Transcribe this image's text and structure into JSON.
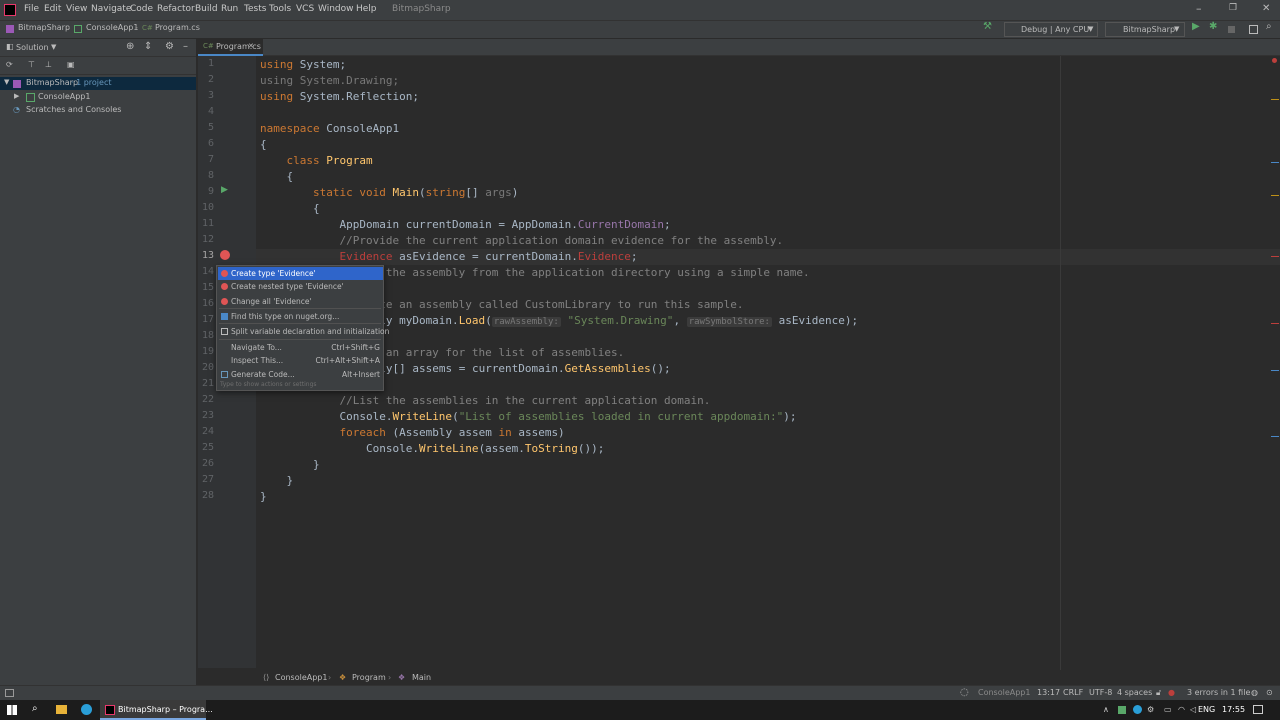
{
  "window": {
    "title": "BitmapSharp",
    "menu": [
      "File",
      "Edit",
      "View",
      "Navigate",
      "Code",
      "Refactor",
      "Build",
      "Run",
      "Tests",
      "Tools",
      "VCS",
      "Window",
      "Help"
    ]
  },
  "navbar": {
    "breadcrumb": [
      "BitmapSharp",
      "ConsoleApp1",
      "Program.cs"
    ],
    "config": "Debug | Any CPU",
    "run_target": "BitmapSharp"
  },
  "solution": {
    "header": "Solution",
    "tree": [
      {
        "label": "BitmapSharp",
        "suffix": " · 1 project"
      },
      {
        "label": "ConsoleApp1",
        "suffix": ""
      },
      {
        "label": "Scratches and Consoles",
        "suffix": ""
      }
    ]
  },
  "editor": {
    "tab": "Program.cs",
    "line_numbers": [
      "1",
      "2",
      "3",
      "4",
      "5",
      "6",
      "7",
      "8",
      "9",
      "10",
      "11",
      "12",
      "13",
      "14",
      "15",
      "16",
      "17",
      "18",
      "19",
      "20",
      "21",
      "22",
      "23",
      "24",
      "25",
      "26",
      "27",
      "28"
    ],
    "code": {
      "l1a": "using",
      "l1b": " System;",
      "l2": "using System.Drawing;",
      "l3a": "using",
      "l3b": " System.Reflection;",
      "l5a": "namespace",
      "l5b": " ConsoleApp1",
      "l6": "{",
      "l7a": "    class ",
      "l7b": "Program",
      "l8": "    {",
      "l9a": "        static void ",
      "l9b": "Main",
      "l9c": "(",
      "l9d": "string",
      "l9e": "[] ",
      "l9f": "args",
      ")": ")",
      "l9g": ")",
      "l10": "        {",
      "l11a": "            AppDomain currentDomain = AppDomain.",
      "l11b": "CurrentDomain",
      ";": ";",
      "l11c": ";",
      "l12": "            //Provide the current application domain evidence for the assembly.",
      "l13a": "            ",
      "l13b": "Evidence",
      " ": " ",
      "l13c": " asEvidence = currentDomain.",
      "l13d": "Evidence",
      "l13e": ";",
      "l14": "            //Load the assembly from the application directory using a simple name.",
      "l16": "            //Create an assembly called CustomLibrary to run this sample.",
      "l17a": "            Assembly myDomain.",
      "l17b": "Load",
      "l17c": "(",
      "l17h1": "rawAssembly:",
      "l17d": " \"System.Drawing\"",
      ", ": ", ",
      "l17e": ", ",
      "l17h2": "rawSymbolStore:",
      "l17f": " asEvidence);",
      "l19": "            //Make an array for the list of assemblies.",
      "l20a": "            Assembly[] ",
      "l20b": "assems",
      " = ": " = ",
      "l20c": " = currentDomain.",
      "l20d": "GetAssemblies",
      "l20e": "();",
      "l22": "            //List the assemblies in the current application domain.",
      "l23a": "            Console.",
      "l23b": "WriteLine",
      "l23c": "(",
      "l23d": "\"List of assemblies loaded in current appdomain:\"",
      "l23e": ");",
      "l24a": "            ",
      "l24b": "foreach",
      " (": " (",
      "l24c": " (Assembly ",
      "l24d": "assem",
      "l24e": " ",
      "l24f": "in",
      " assems)": " assems)",
      "l24g": " assems)",
      "l25a": "                Console.",
      "l25b": "WriteLine",
      "l25c": "(assem.",
      "l25d": "ToString",
      "l25e": "());",
      "l26": "        }",
      "l27": "    }",
      "l28": "}"
    }
  },
  "popup": {
    "items": [
      {
        "label": "Create type 'Evidence'",
        "shortcut": ""
      },
      {
        "label": "Create nested type 'Evidence'",
        "shortcut": ""
      },
      {
        "label": "Change all 'Evidence'",
        "shortcut": ""
      },
      {
        "label": "Find this type on nuget.org...",
        "shortcut": ""
      },
      {
        "label": "Split variable declaration and initialization",
        "shortcut": ""
      },
      {
        "label": "Navigate To...",
        "shortcut": "Ctrl+Shift+G"
      },
      {
        "label": "Inspect This...",
        "shortcut": "Ctrl+Alt+Shift+A"
      },
      {
        "label": "Generate Code...",
        "shortcut": "Alt+Insert"
      }
    ],
    "footer": "Type to show actions or settings"
  },
  "breadcrumbs_bottom": [
    "ConsoleApp1",
    "Program",
    "Main"
  ],
  "status": {
    "project": "ConsoleApp1",
    "position": "13:17",
    "line_ending": "CRLF",
    "encoding": "UTF-8",
    "indent": "4 spaces",
    "errors": "3 errors in 1 file"
  },
  "taskbar": {
    "app": "BitmapSharp – Progra...",
    "lang": "ENG",
    "time": "17:55"
  },
  "colors": {
    "accent": "#2f65ca",
    "keyword": "#cc7832",
    "error": "#bc3f3c"
  }
}
